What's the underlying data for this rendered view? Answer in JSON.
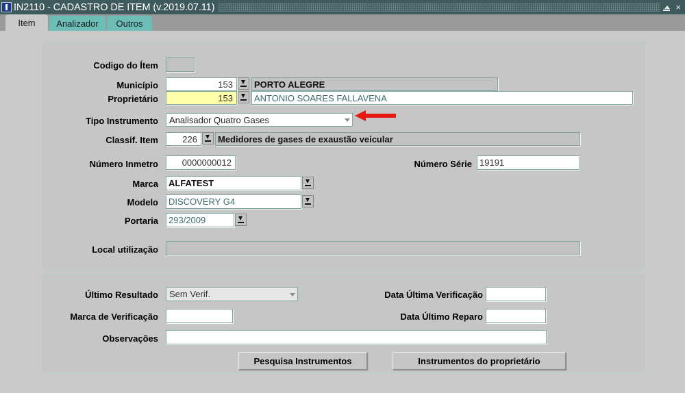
{
  "window": {
    "title": "IN2110 - CADASTRO DE ITEM (v.2019.07.11)",
    "icon": "app-icon",
    "restore_label": "restore-icon",
    "close_label": "×"
  },
  "tabs": [
    {
      "label": "Item",
      "active": true
    },
    {
      "label": "Analizador",
      "active": false
    },
    {
      "label": "Outros",
      "active": false
    }
  ],
  "form": {
    "codigo_item": {
      "label": "Codigo do Ítem",
      "value": ""
    },
    "municipio": {
      "label": "Município",
      "code": "153",
      "description": "PORTO ALEGRE",
      "lov": "lov-arrow-icon"
    },
    "proprietario": {
      "label": "Proprietário",
      "code": "153",
      "description": "ANTONIO SOARES FALLAVENA",
      "lov": "lov-arrow-icon"
    },
    "tipo_instrumento": {
      "label": "Tipo Instrumento",
      "value": "Analisador Quatro Gases",
      "arrow": "chevron-down-icon"
    },
    "classif_item": {
      "label": "Classif. Item",
      "code": "226",
      "description": "Medidores de gases de exaustão veicular",
      "lov": "lov-arrow-icon"
    },
    "numero_inmetro": {
      "label": "Número Inmetro",
      "value": "0000000012"
    },
    "numero_serie": {
      "label": "Número Série",
      "value": "19191"
    },
    "marca": {
      "label": "Marca",
      "value": "ALFATEST",
      "lov": "lov-arrow-icon"
    },
    "modelo": {
      "label": "Modelo",
      "value": "DISCOVERY G4",
      "lov": "lov-arrow-icon"
    },
    "portaria": {
      "label": "Portaria",
      "value": "293/2009",
      "lov": "lov-arrow-icon"
    },
    "local_utilizacao": {
      "label": "Local utilização",
      "value": ""
    }
  },
  "result_panel": {
    "ultimo_resultado": {
      "label": "Último Resultado",
      "value": "Sem Verif.",
      "arrow": "chevron-down-icon"
    },
    "marca_verificacao": {
      "label": "Marca de Verificação",
      "value": ""
    },
    "observacoes": {
      "label": "Observações",
      "value": ""
    },
    "data_ultima_verificacao": {
      "label": "Data Última Verificação",
      "value": ""
    },
    "data_ultimo_reparo": {
      "label": "Data Último Reparo",
      "value": ""
    }
  },
  "buttons": {
    "pesquisa_instrumentos": "Pesquisa Instrumentos",
    "instrumentos_proprietario": "Instrumentos do proprietário"
  },
  "annotation": {
    "arrow_color": "#e81b12",
    "arrow_target": "tipo-instrumento-combo"
  },
  "colors": {
    "titlebar": "#3f5a5c",
    "tab_inactive": "#6bbdb5",
    "tab_active": "#c9c9c9",
    "form_background": "#c9c9c9",
    "field_border": "#7fa5a3",
    "highlight_field": "#ffffaa"
  }
}
